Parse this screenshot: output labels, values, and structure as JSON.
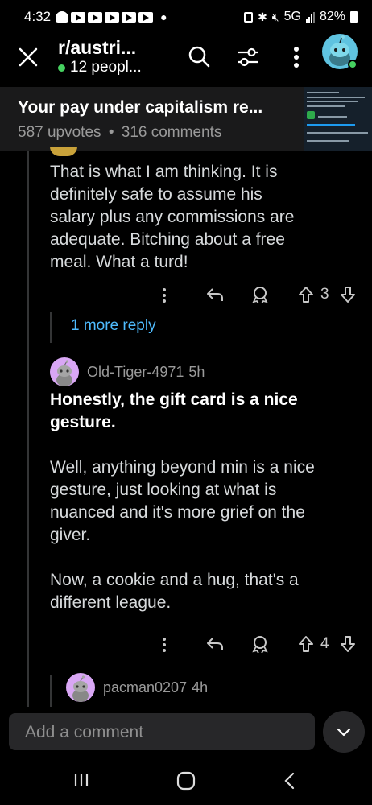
{
  "status_bar": {
    "time": "4:32",
    "network": "5G",
    "battery": "82%"
  },
  "header": {
    "subreddit": "r/austri...",
    "online": "12 peopl..."
  },
  "post": {
    "title": "Your pay under capitalism re...",
    "upvotes": "587 upvotes",
    "separator": "•",
    "comments": "316 comments"
  },
  "comments": [
    {
      "text": [
        "That is what I am thinking. It is",
        "definitely safe to assume his",
        "salary plus any commissions are",
        "adequate. Bitching about a free",
        "meal. What a turd!"
      ],
      "votes": "3"
    },
    {
      "more_reply": "1 more reply"
    },
    {
      "author": "Old-Tiger-4971",
      "time": "5h",
      "bold_lines": [
        "Honestly, the gift card is a nice",
        "gesture."
      ],
      "para1": [
        "Well, anything beyond min is a nice",
        "gesture, just looking at what is",
        "nuanced and it's more grief on the",
        "giver."
      ],
      "para2": [
        "Now, a cookie and a hug, that's a",
        "different league."
      ],
      "votes": "4"
    },
    {
      "author": "pacman0207",
      "time": "4h"
    }
  ],
  "bottom": {
    "placeholder": "Add a comment"
  },
  "colors": {
    "background": "#000000",
    "link": "#4fbcff",
    "online": "#46d160",
    "avatar_bg": "#d9a7f5"
  }
}
